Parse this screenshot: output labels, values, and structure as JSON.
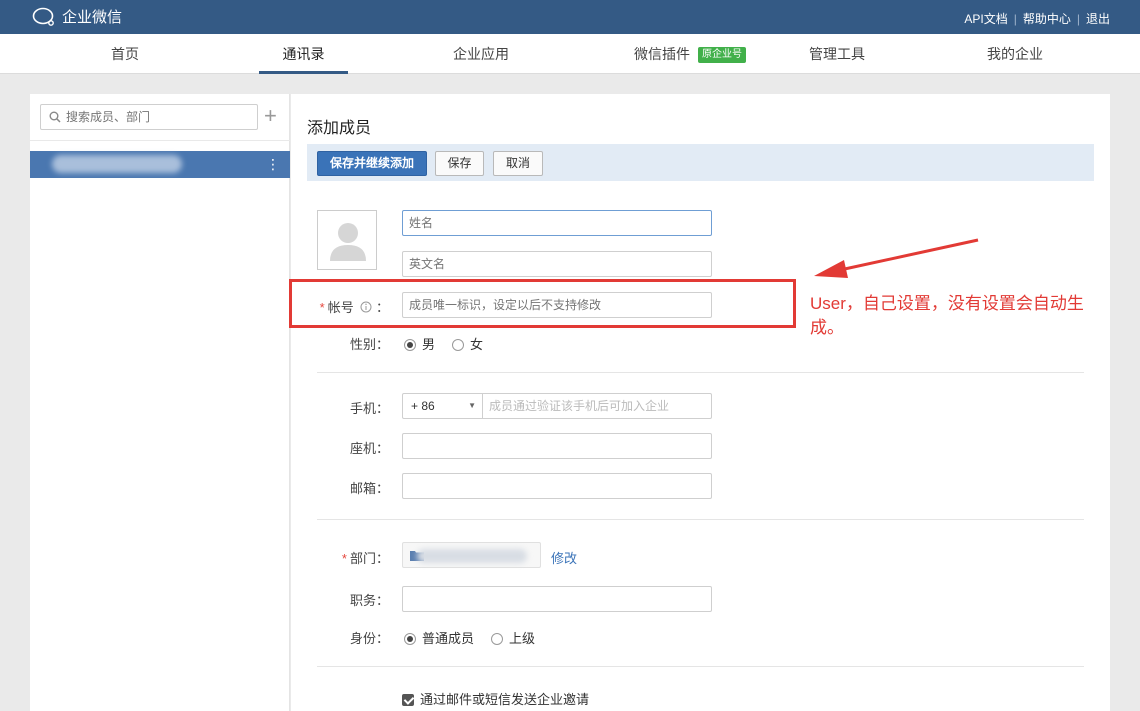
{
  "topbar": {
    "app_name": "企业微信",
    "links": [
      "API文档",
      "帮助中心",
      "退出"
    ],
    "bg_color": "#345a85"
  },
  "nav": {
    "items": [
      {
        "label": "首页"
      },
      {
        "label": "通讯录",
        "active": true
      },
      {
        "label": "企业应用"
      },
      {
        "label": "微信插件",
        "badge": "原企业号"
      },
      {
        "label": "管理工具"
      },
      {
        "label": "我的企业"
      }
    ]
  },
  "sidebar": {
    "search_placeholder": "搜索成员、部门",
    "add_icon": "plus-icon",
    "more_icon": "vertical-dots-icon"
  },
  "main": {
    "title": "添加成员",
    "buttons": {
      "save_continue": "保存并继续添加",
      "save": "保存",
      "cancel": "取消"
    },
    "form": {
      "name_placeholder": "姓名",
      "english_name_placeholder": "英文名",
      "account_label": "帐号",
      "account_placeholder": "成员唯一标识，设定以后不支持修改",
      "gender_label": "性别：",
      "gender_options": [
        "男",
        "女"
      ],
      "gender_selected": "男",
      "mobile_label": "手机：",
      "mobile_code": "+ 86",
      "mobile_placeholder": "成员通过验证该手机后可加入企业",
      "landline_label": "座机：",
      "email_label": "邮箱：",
      "department_label": "部门：",
      "department_edit": "修改",
      "position_label": "职务：",
      "identity_label": "身份：",
      "identity_options": [
        "普通成员",
        "上级"
      ],
      "identity_selected": "普通成员",
      "invite_label": "通过邮件或短信发送企业邀请",
      "invite_checked": true
    }
  },
  "annotation": {
    "text": "User，自己设置，没有设置会自动生成。",
    "color": "#e23a35"
  }
}
